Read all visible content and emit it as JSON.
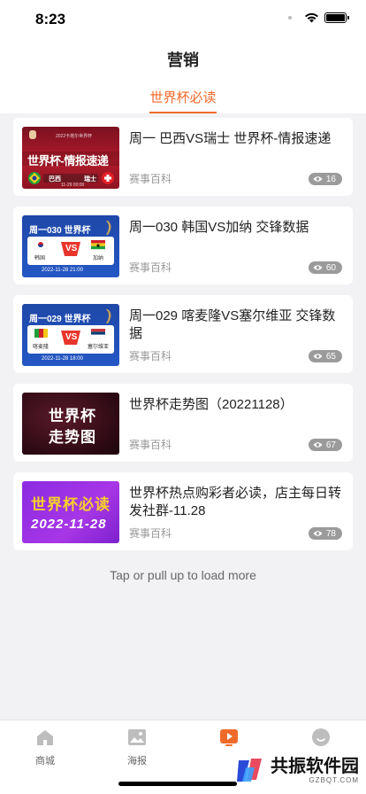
{
  "status": {
    "time": "8:23"
  },
  "header": {
    "title": "营销"
  },
  "tabs": [
    {
      "label": "世界杯必读"
    }
  ],
  "articles": [
    {
      "title": "周一 巴西VS瑞士 世界杯-情报速递",
      "source": "赛事百科",
      "views": "16",
      "thumb_text": "世界杯-情报速递",
      "thumb_sub": "巴西",
      "thumb_sub2": "瑞士",
      "thumb_small": "2022卡塔尔世界杯",
      "thumb_date": "11-29 00:00"
    },
    {
      "title": "周一030 韩国VS加纳 交锋数据",
      "source": "赛事百科",
      "views": "60",
      "thumb_text": "周一030 世界杯",
      "thumb_team1": "韩国",
      "thumb_team2": "加纳",
      "thumb_date": "2022-11-28 21:00"
    },
    {
      "title": "周一029 喀麦隆VS塞尔维亚 交锋数据",
      "source": "赛事百科",
      "views": "65",
      "thumb_text": "周一029 世界杯",
      "thumb_team1": "喀麦隆",
      "thumb_team2": "塞尔维亚",
      "thumb_date": "2022-11-28 18:00"
    },
    {
      "title": "世界杯走势图（20221128）",
      "source": "赛事百科",
      "views": "67",
      "thumb_line1": "世界杯",
      "thumb_line2": "走势图"
    },
    {
      "title": "世界杯热点购彩者必读，店主每日转发社群-11.28",
      "source": "赛事百科",
      "views": "78",
      "thumb_line1": "世界杯必读",
      "thumb_line2": "2022-11-28"
    }
  ],
  "load_more": "Tap or pull up to load more",
  "tabbar": [
    {
      "label": "商城",
      "icon": "home-icon"
    },
    {
      "label": "海报",
      "icon": "image-icon"
    },
    {
      "label": "",
      "icon": "play-icon",
      "active": true
    },
    {
      "label": "",
      "icon": "profile-icon"
    }
  ],
  "watermark": {
    "text": "共振软件园",
    "sub": "GZBQT.COM"
  },
  "colors": {
    "accent": "#f06a2a",
    "background": "#f2f2f4"
  }
}
